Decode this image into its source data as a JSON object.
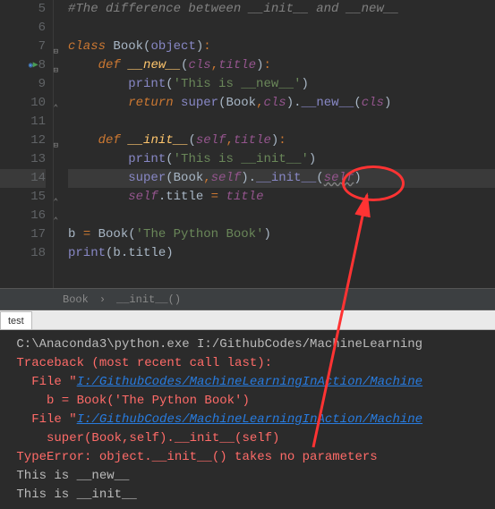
{
  "gutter": {
    "lines": [
      "5",
      "6",
      "7",
      "8",
      "9",
      "10",
      "11",
      "12",
      "13",
      "14",
      "15",
      "16",
      "17",
      "18"
    ]
  },
  "code": {
    "l5": "#The difference between __init__ and __new__",
    "classkw": "class",
    "classname": "Book",
    "objbase": "object",
    "defkw1": "def",
    "newname": "__new__",
    "cls1": "cls",
    "title1": "title",
    "print1": "print",
    "str_new": "'This is __new__'",
    "returnkw": "return",
    "superkw1": "super",
    "book1": "Book",
    "cls2": "cls",
    "newcall": "__new__",
    "cls3": "cls",
    "defkw2": "def",
    "initname": "__init__",
    "self1": "self",
    "title2": "title",
    "print2": "print",
    "str_init": "'This is __init__'",
    "superkw2": "super",
    "book2": "Book",
    "self2": "self",
    "initcall": "__init__",
    "self3": "self",
    "self4": "self",
    "titleattr": "title",
    "titlep": "title",
    "bvar": "b",
    "bookctor": "Book",
    "str_book": "'The Python Book'",
    "printlast": "print",
    "bvar2": "b",
    "titlelast": "title"
  },
  "breadcrumb": {
    "a": "Book",
    "sep": "›",
    "b": "__init__()"
  },
  "tab": {
    "label": "test"
  },
  "console": {
    "l1": " C:\\Anaconda3\\python.exe I:/GithubCodes/MachineLearning",
    "l2": " Traceback (most recent call last):",
    "l3a": "   File \"",
    "l3b": "I:/GithubCodes/MachineLearningInAction/Machine",
    "l4": "     b = Book('The Python Book')",
    "l5a": "   File \"",
    "l5b": "I:/GithubCodes/MachineLearningInAction/Machine",
    "l6": "     super(Book,self).__init__(self)",
    "l7": " TypeError: object.__init__() takes no parameters",
    "l8": " This is __new__",
    "l9": " This is __init__"
  }
}
